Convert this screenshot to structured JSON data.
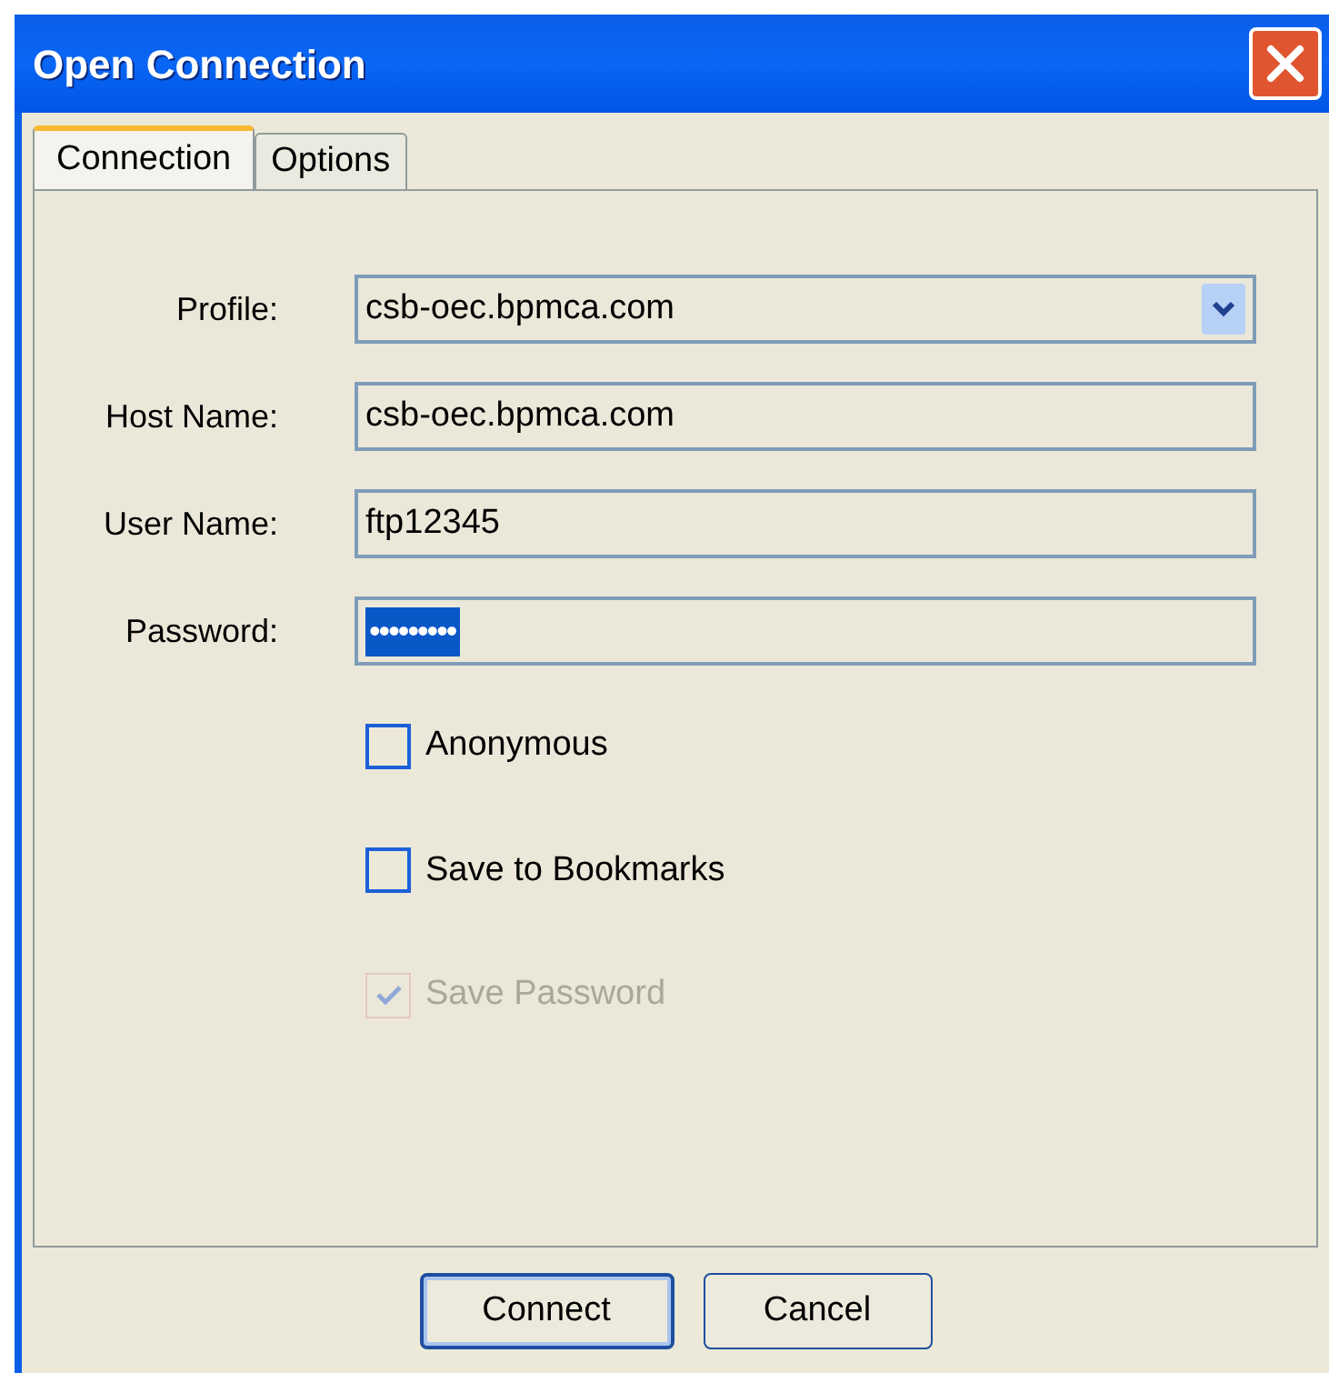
{
  "window": {
    "title": "Open Connection"
  },
  "tabs": [
    {
      "label": "Connection",
      "selected": true
    },
    {
      "label": "Options",
      "selected": false
    }
  ],
  "fields": [
    {
      "kind": "dropdown",
      "label": "Profile:",
      "value": "csb-oec.bpmca.com",
      "selected": false
    },
    {
      "kind": "text",
      "label": "Host Name:",
      "value": "csb-oec.bpmca.com",
      "selected": false
    },
    {
      "kind": "text",
      "label": "User Name:",
      "value": "ftp12345",
      "selected": false
    },
    {
      "kind": "password",
      "label": "Password:",
      "value": "•••••••••",
      "selected": true
    }
  ],
  "checkboxes": [
    {
      "label": "Anonymous",
      "checked": false,
      "disabled": false
    },
    {
      "label": "Save to Bookmarks",
      "checked": false,
      "disabled": false
    },
    {
      "label": "Save Password",
      "checked": true,
      "disabled": true
    }
  ],
  "buttons": [
    {
      "label": "Connect",
      "default": true
    },
    {
      "label": "Cancel",
      "default": false
    }
  ]
}
